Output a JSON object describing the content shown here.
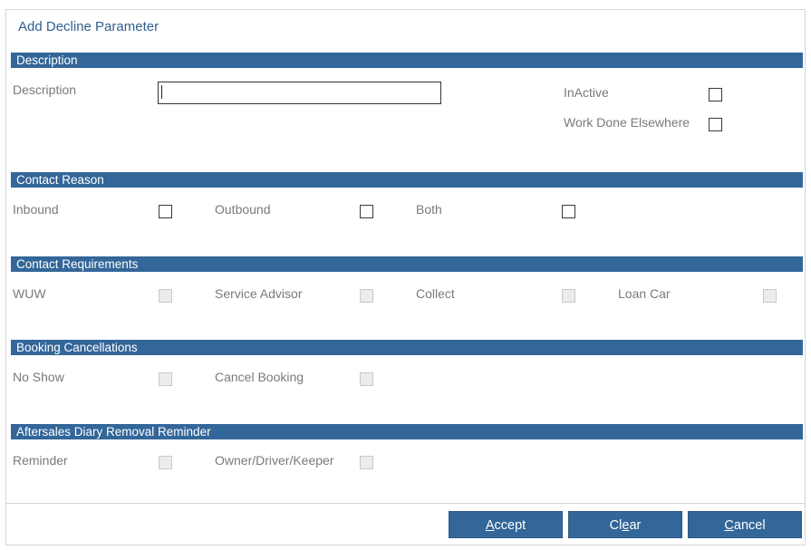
{
  "dialog": {
    "title": "Add Decline Parameter"
  },
  "description_section": {
    "header": "Description",
    "description_label": "Description",
    "description_value": "",
    "inactive_label": "InActive",
    "work_done_elsewhere_label": "Work Done Elsewhere"
  },
  "contact_reason": {
    "header": "Contact Reason",
    "inbound_label": "Inbound",
    "outbound_label": "Outbound",
    "both_label": "Both"
  },
  "contact_requirements": {
    "header": "Contact Requirements",
    "wuw_label": "WUW",
    "service_advisor_label": "Service Advisor",
    "collect_label": "Collect",
    "loan_car_label": "Loan Car"
  },
  "booking_cancellations": {
    "header": "Booking Cancellations",
    "no_show_label": "No Show",
    "cancel_booking_label": "Cancel Booking"
  },
  "aftersales": {
    "header": "Aftersales Diary Removal Reminder",
    "reminder_label": "Reminder",
    "owner_label": "Owner/Driver/Keeper"
  },
  "buttons": {
    "accept_key": "A",
    "accept_rest": "ccept",
    "clear_first": "Cl",
    "clear_key": "e",
    "clear_rest": "ar",
    "cancel_key": "C",
    "cancel_rest": "ancel"
  },
  "colors": {
    "accent": "#336699",
    "title": "#2e5f8f",
    "label": "#7a7a7a"
  }
}
